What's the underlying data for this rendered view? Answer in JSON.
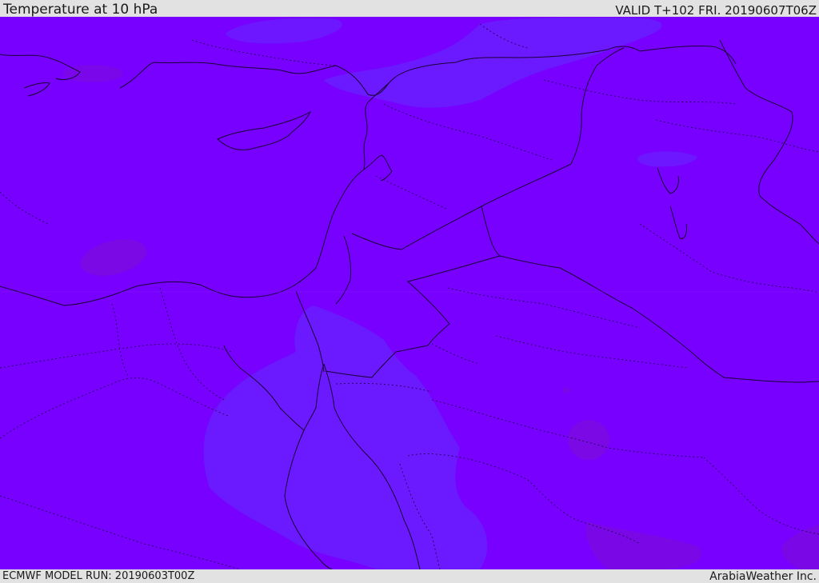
{
  "header": {
    "title": "Temperature at 10 hPa",
    "valid": "VALID T+102 FRI. 20190607T06Z"
  },
  "footer": {
    "model_run": "ECMWF MODEL RUN: 20190603T00Z",
    "credit": "ArabiaWeather Inc."
  },
  "map": {
    "field": "temperature-10hPa",
    "colors": {
      "background": "#7700ff",
      "warm_band": "#6a1aff",
      "cold_patch": "#7a0ae0",
      "coastline": "#1a0033",
      "border": "#1a0033"
    }
  }
}
